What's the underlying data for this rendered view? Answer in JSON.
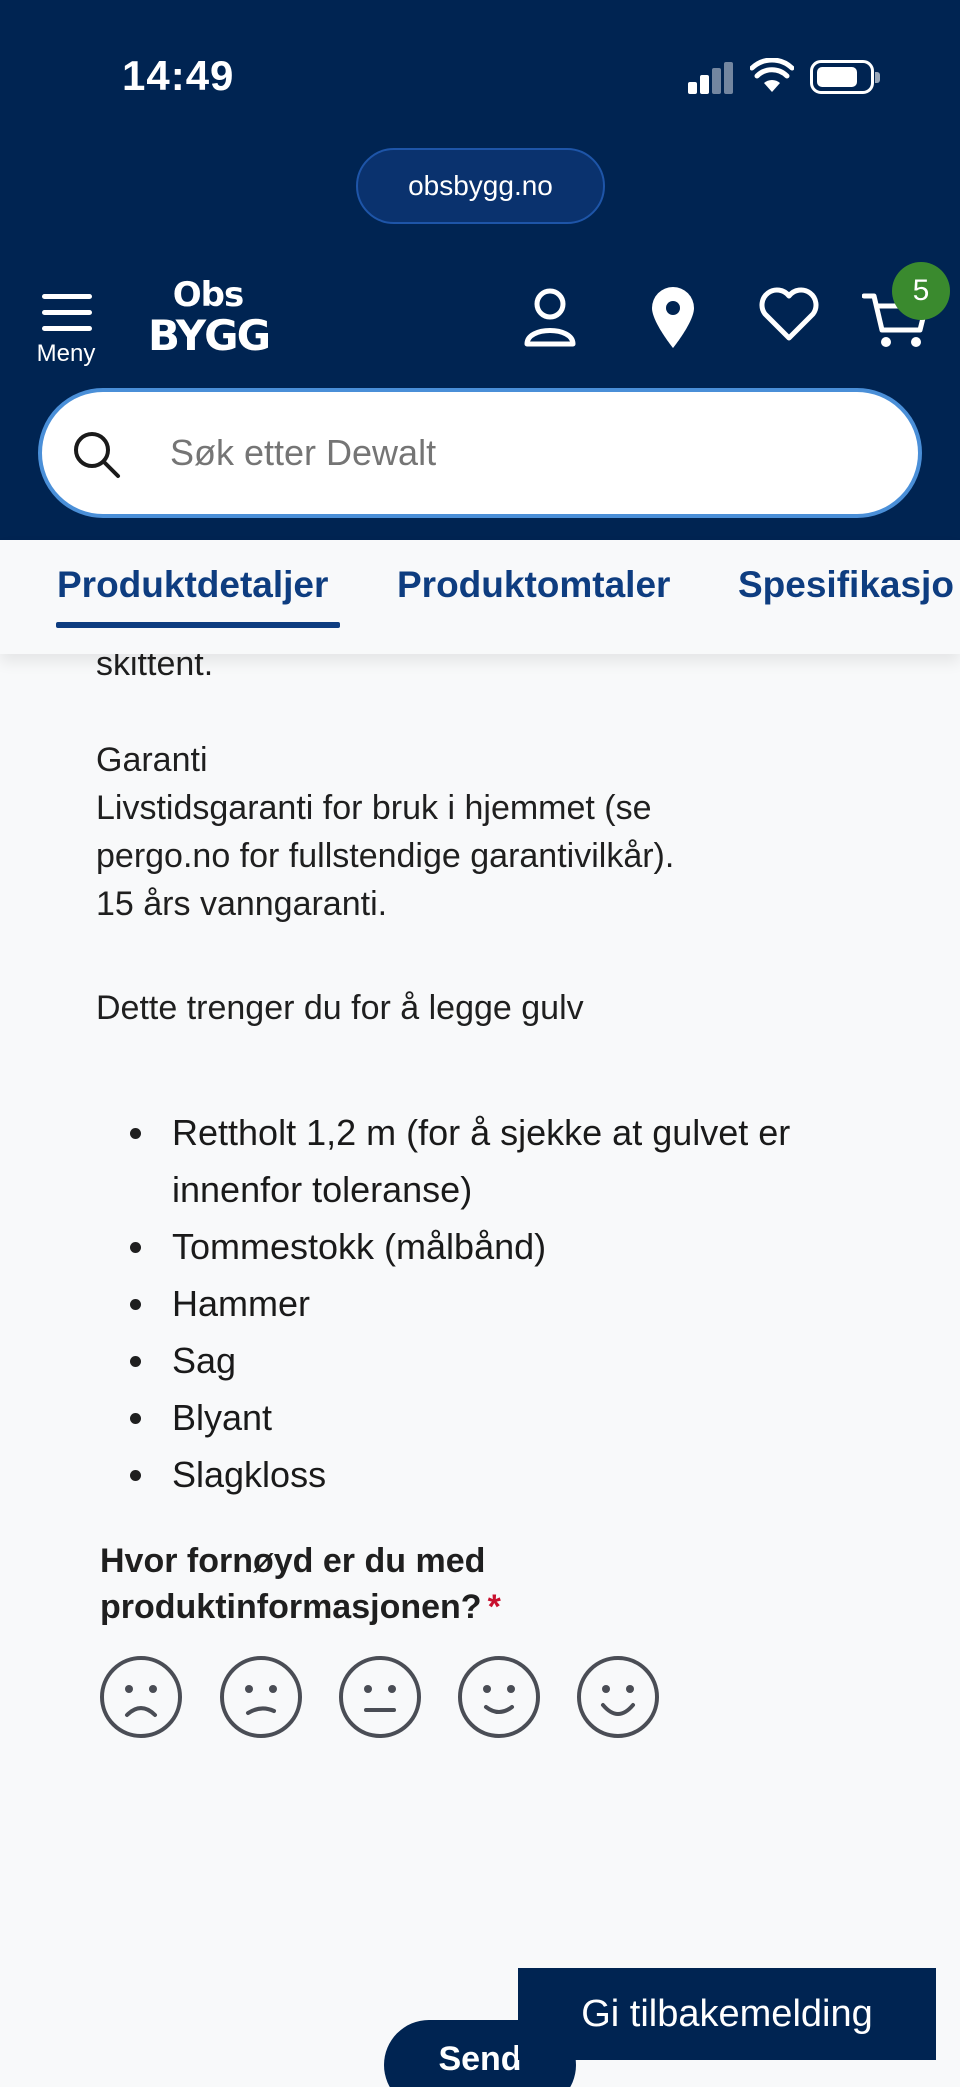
{
  "status_bar": {
    "time": "14:49"
  },
  "browser": {
    "url": "obsbygg.no"
  },
  "header": {
    "menu_label": "Meny",
    "logo_line1": "Obs",
    "logo_line2": "BYGG",
    "cart_count": "5"
  },
  "search": {
    "placeholder": "Søk etter Dewalt"
  },
  "tabs": [
    {
      "label": "Produktdetaljer",
      "active": true
    },
    {
      "label": "Produktomtaler",
      "active": false
    },
    {
      "label": "Spesifikasjo",
      "active": false
    }
  ],
  "content": {
    "cut_text": "skittent.",
    "warranty_title": "Garanti",
    "warranty_lines": [
      "Livstidsgaranti for bruk i hjemmet (se",
      "pergo.no for fullstendige garantivilkår).",
      "15 års vanngaranti."
    ],
    "tools_heading": "Dette trenger du for å legge gulv",
    "tools": [
      "Rettholt 1,2 m (for å sjekke at gulvet er innenfor toleranse)",
      "Tommestokk (målbånd)",
      "Hammer",
      "Sag",
      "Blyant",
      "Slagkloss"
    ]
  },
  "rating": {
    "question": "Hvor fornøyd er du med produktinformasjonen?",
    "required_marker": "*",
    "faces": [
      "very-unhappy-face-icon",
      "unhappy-face-icon",
      "neutral-face-icon",
      "happy-face-icon",
      "very-happy-face-icon"
    ]
  },
  "buttons": {
    "feedback": "Gi tilbakemelding",
    "send": "Send"
  },
  "colors": {
    "header_bg": "#002452",
    "accent": "#0e3d80",
    "badge": "#3a8a2e",
    "required": "#c8102e"
  }
}
